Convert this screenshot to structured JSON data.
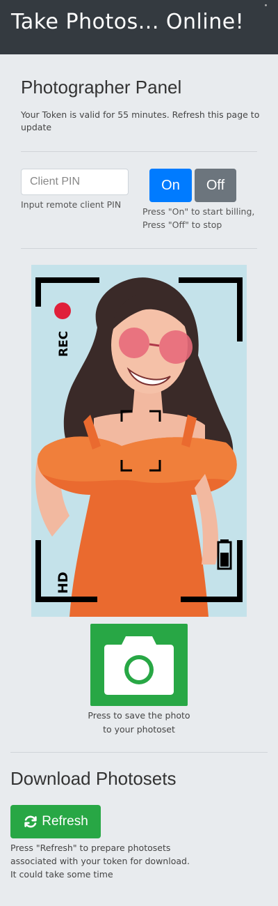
{
  "header": {
    "title": "Take Photos... Online!"
  },
  "panel": {
    "heading": "Photographer Panel",
    "token_text": "Your Token is valid for 55 minutes. Refresh this page to update"
  },
  "pin": {
    "placeholder": "Client PIN",
    "value": "",
    "help": "Input remote client PIN"
  },
  "billing": {
    "on_label": "On",
    "off_label": "Off",
    "help": "Press \"On\" to start billing, Press \"Off\" to stop"
  },
  "camera": {
    "rec_label": "REC",
    "hd_label": "HD",
    "icons": [
      "record-dot-icon",
      "battery-icon",
      "focus-bracket-icon"
    ]
  },
  "shutter": {
    "icon": "camera-icon",
    "help_line1": "Press to save the photo",
    "help_line2": "to your photoset"
  },
  "download": {
    "heading": "Download Photosets",
    "refresh_label": "Refresh",
    "refresh_icon": "sync-icon",
    "help_line1": "Press \"Refresh\" to prepare photosets",
    "help_line2": "associated with your token for download.",
    "help_line3": "It could take some time"
  },
  "colors": {
    "navbar": "#343a40",
    "primary": "#007bff",
    "secondary": "#6c757d",
    "success": "#28a745",
    "background": "#e8ebee"
  }
}
